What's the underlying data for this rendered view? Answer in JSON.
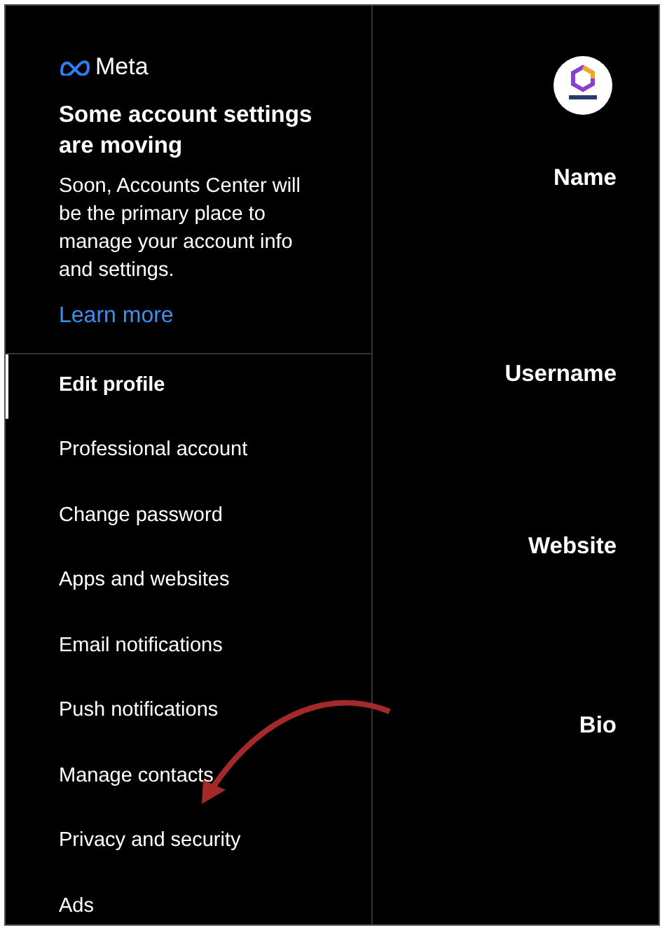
{
  "banner": {
    "brand": "Meta",
    "title": "Some account settings are moving",
    "body": "Soon, Accounts Center will be the primary place to manage your account info and settings.",
    "link": "Learn more"
  },
  "menu": [
    {
      "label": "Edit profile",
      "selected": true
    },
    {
      "label": "Professional account",
      "selected": false
    },
    {
      "label": "Change password",
      "selected": false
    },
    {
      "label": "Apps and websites",
      "selected": false
    },
    {
      "label": "Email notifications",
      "selected": false
    },
    {
      "label": "Push notifications",
      "selected": false
    },
    {
      "label": "Manage contacts",
      "selected": false
    },
    {
      "label": "Privacy and security",
      "selected": false
    },
    {
      "label": "Ads",
      "selected": false
    }
  ],
  "form": {
    "fields": [
      {
        "label": "Name"
      },
      {
        "label": "Username"
      },
      {
        "label": "Website"
      },
      {
        "label": "Bio"
      }
    ]
  }
}
